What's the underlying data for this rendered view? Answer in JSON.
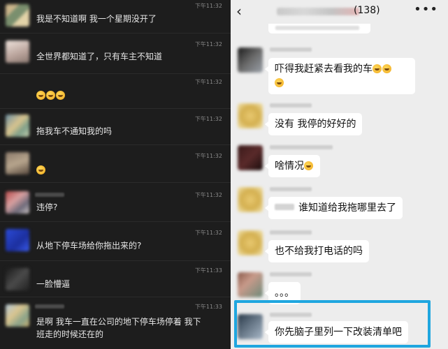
{
  "left_panel": {
    "messages": [
      {
        "time": "下午11:32",
        "text": "我是不知道啊 我一个星期没开了",
        "emoji_count": 0
      },
      {
        "time": "下午11:32",
        "text": "全世界都知道了，只有车主不知道",
        "emoji_count": 0
      },
      {
        "time": "下午11:32",
        "text": "",
        "emoji_count": 3
      },
      {
        "time": "下午11:32",
        "text": "拖我车不通知我的吗",
        "emoji_count": 0
      },
      {
        "time": "下午11:32",
        "text": "",
        "emoji_count": 1
      },
      {
        "time": "下午11:32",
        "text": "违停?",
        "emoji_count": 0
      },
      {
        "time": "下午11:32",
        "text": "从地下停车场给你拖出来的?",
        "emoji_count": 0
      },
      {
        "time": "下午11:33",
        "text": "一脸懵逼",
        "emoji_count": 0
      },
      {
        "time": "下午11:33",
        "text_line1": "是啊 我车一直在公司的地下停车场停着 我下",
        "text_line2": "班走的时候还在的",
        "emoji_count": 0
      }
    ]
  },
  "right_panel": {
    "header": {
      "back_icon": "chevron-left-icon",
      "member_count": "(138)",
      "more_icon": "ellipsis-icon"
    },
    "messages": [
      {
        "text": "吓得我赶紧去看我的车",
        "text_line2": "",
        "emoji_count": 3
      },
      {
        "text": "没有 我停的好好的",
        "emoji_count": 0
      },
      {
        "text": "啥情况",
        "emoji_count": 1
      },
      {
        "text": "谁知道给我拖哪里去了",
        "emoji_count": 0
      },
      {
        "text": "也不给我打电话的吗",
        "emoji_count": 0
      },
      {
        "text": "。。。",
        "emoji_count": 0
      },
      {
        "text": "你先脑子里列一下改装清单吧",
        "emoji_count": 0
      }
    ]
  },
  "colors": {
    "left_bg": "#1d1d1d",
    "right_bg": "#ededed",
    "bubble": "#ffffff",
    "highlight_border": "#1fa6df"
  }
}
